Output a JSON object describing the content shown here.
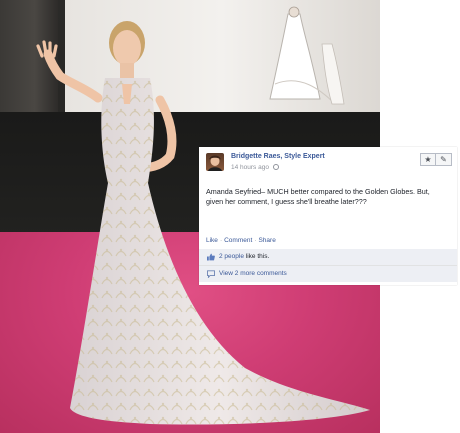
{
  "comment": {
    "author": "Bridgette Raes, Style Expert",
    "timestamp": "14 hours ago",
    "body": "Amanda Seyfried– MUCH better compared to the Golden Globes. But, given her comment, I guess she'll breathe later???",
    "buttons": {
      "star": "★",
      "edit": "✎"
    },
    "actions": {
      "like": "Like",
      "comment": "Comment",
      "share": "Share",
      "separator": "·"
    },
    "likes": {
      "link": "2 people",
      "rest": "like this."
    },
    "view_more": "View 2 more comments"
  },
  "colors": {
    "link": "#3b5998",
    "panel": "#edeff4",
    "carpet": "#cf3d74"
  }
}
